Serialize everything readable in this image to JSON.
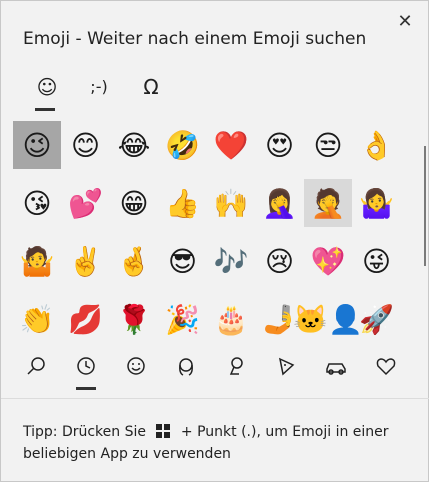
{
  "window": {
    "title": "Emoji - Weiter nach einem Emoji suchen",
    "close_label": "✕"
  },
  "categories": [
    {
      "icon": "smiley-icon",
      "glyph": "☺"
    },
    {
      "icon": "kaomoji-icon",
      "glyph": ";-)"
    },
    {
      "icon": "symbols-icon",
      "glyph": "Ω"
    }
  ],
  "emojis": [
    "😉",
    "😊",
    "😂",
    "🤣",
    "❤️",
    "😍",
    "😒",
    "👌",
    "😘",
    "💕",
    "😁",
    "👍",
    "🙌",
    "🤦‍♀️",
    "🤦",
    "🤷‍♀️",
    "🤷",
    "✌️",
    "🤞",
    "😎",
    "🎶",
    "😢",
    "💖",
    "😜",
    "👏",
    "💋",
    "🌹",
    "🎉",
    "🎂",
    "🤳",
    "🐱‍👤",
    "🚀",
    "💯",
    "🎁",
    "🌸",
    "🌍",
    "🐶",
    "😽",
    "👀",
    "😀"
  ],
  "bottom_tabs": [
    {
      "icon": "search-icon",
      "glyph": "⚲"
    },
    {
      "icon": "clock-icon",
      "glyph": "🕓"
    },
    {
      "icon": "smiley-face-icon",
      "glyph": "☺"
    },
    {
      "icon": "person-icon",
      "glyph": "☻"
    },
    {
      "icon": "location-icon",
      "glyph": "⚲"
    },
    {
      "icon": "pizza-icon",
      "glyph": "◬"
    },
    {
      "icon": "car-icon",
      "glyph": "🚗"
    },
    {
      "icon": "heart-icon",
      "glyph": "♡"
    }
  ],
  "tip": {
    "prefix": "Tipp: Drücken Sie",
    "suffix": "+ Punkt (.), um Emoji in einer beliebigen App zu verwenden"
  }
}
